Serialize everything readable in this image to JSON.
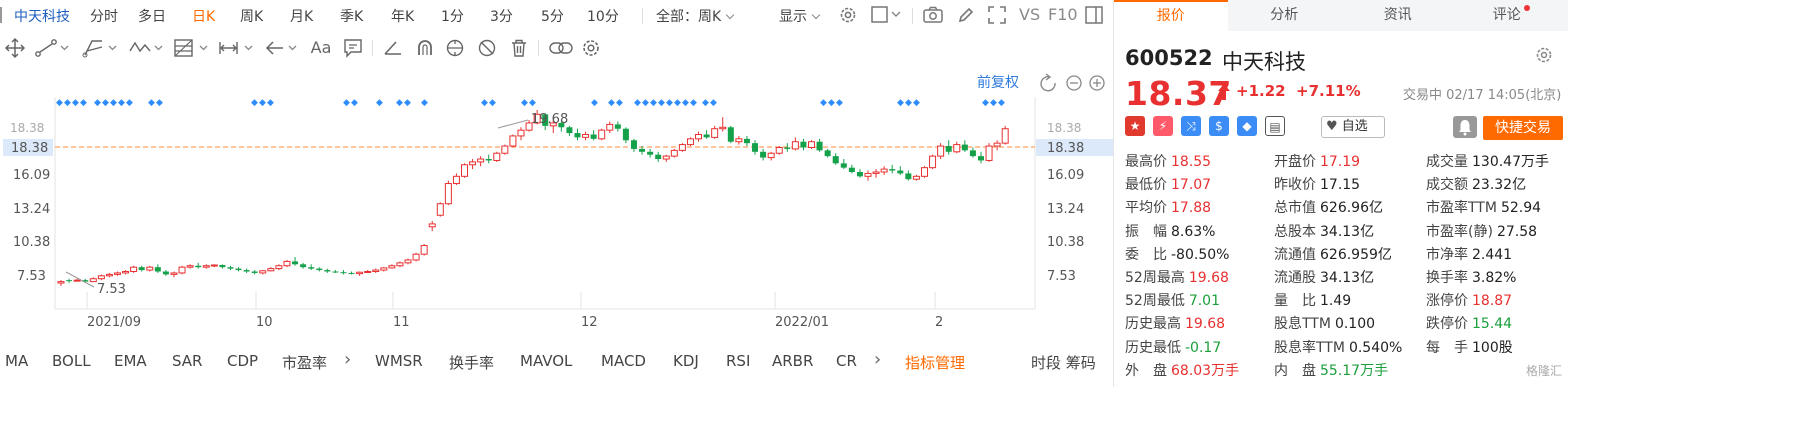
{
  "tabs": {
    "name": "中天科技",
    "items": [
      "分时",
      "多日",
      "日K",
      "周K",
      "月K",
      "季K",
      "年K",
      "1分",
      "3分",
      "5分",
      "10分"
    ],
    "active": "日K",
    "adjust_select": "全部：周K",
    "display": "显示",
    "vs_label": "VS",
    "f10_label": "F10"
  },
  "chart": {
    "adjust_label": "前复权",
    "price_levels": [
      "18.38",
      "16.09",
      "13.24",
      "10.38",
      "7.53"
    ],
    "current_price_tag": "18.38",
    "annotation_high": "19.68",
    "annotation_low": "7.53",
    "x_labels": [
      "2021/09",
      "10",
      "11",
      "12",
      "2022/01",
      "2"
    ],
    "colors": {
      "up": "#e93030",
      "down": "#14a14a",
      "ref_line": "#ff8a3d",
      "marker": "#2f8cff"
    }
  },
  "chart_data": {
    "type": "candlestick",
    "ylim": [
      5.9,
      20.6
    ],
    "y_ticks": [
      7.53,
      10.38,
      13.24,
      16.09,
      18.38
    ],
    "x_labels": [
      "2021/09",
      "10",
      "11",
      "12",
      "2022/01",
      "2"
    ],
    "high_marker": 19.68,
    "low_marker": 7.53,
    "reference_price": 18.38,
    "ohlc": [
      [
        7.7,
        7.9,
        7.5,
        7.8
      ],
      [
        7.9,
        8.0,
        7.7,
        7.85
      ],
      [
        7.85,
        8.0,
        7.8,
        7.9
      ],
      [
        7.9,
        8.0,
        7.7,
        7.8
      ],
      [
        7.8,
        8.1,
        7.8,
        8.0
      ],
      [
        8.0,
        8.3,
        7.9,
        8.2
      ],
      [
        8.2,
        8.4,
        8.1,
        8.3
      ],
      [
        8.3,
        8.5,
        8.2,
        8.4
      ],
      [
        8.4,
        8.6,
        8.3,
        8.5
      ],
      [
        8.5,
        8.9,
        8.4,
        8.8
      ],
      [
        8.8,
        8.9,
        8.5,
        8.6
      ],
      [
        8.6,
        8.9,
        8.5,
        8.8
      ],
      [
        8.8,
        9.0,
        8.4,
        8.5
      ],
      [
        8.5,
        8.6,
        8.2,
        8.3
      ],
      [
        8.3,
        8.5,
        8.1,
        8.4
      ],
      [
        8.4,
        8.9,
        8.3,
        8.8
      ],
      [
        8.8,
        9.0,
        8.7,
        8.9
      ],
      [
        8.9,
        9.1,
        8.7,
        8.8
      ],
      [
        8.8,
        9.0,
        8.7,
        8.9
      ],
      [
        8.9,
        9.0,
        8.8,
        8.95
      ],
      [
        8.95,
        9.0,
        8.7,
        8.8
      ],
      [
        8.8,
        8.9,
        8.6,
        8.7
      ],
      [
        8.7,
        8.8,
        8.5,
        8.6
      ],
      [
        8.6,
        8.7,
        8.4,
        8.5
      ],
      [
        8.5,
        8.6,
        8.3,
        8.4
      ],
      [
        8.4,
        8.6,
        8.3,
        8.55
      ],
      [
        8.55,
        8.8,
        8.5,
        8.7
      ],
      [
        8.7,
        9.0,
        8.6,
        8.9
      ],
      [
        8.9,
        9.3,
        8.8,
        9.2
      ],
      [
        9.2,
        9.5,
        8.9,
        9.0
      ],
      [
        9.0,
        9.1,
        8.7,
        8.8
      ],
      [
        8.8,
        9.0,
        8.6,
        8.7
      ],
      [
        8.7,
        8.8,
        8.5,
        8.6
      ],
      [
        8.6,
        8.7,
        8.4,
        8.5
      ],
      [
        8.5,
        8.6,
        8.4,
        8.45
      ],
      [
        8.45,
        8.6,
        8.3,
        8.4
      ],
      [
        8.4,
        8.5,
        8.3,
        8.35
      ],
      [
        8.35,
        8.5,
        8.2,
        8.45
      ],
      [
        8.45,
        8.6,
        8.4,
        8.5
      ],
      [
        8.5,
        8.7,
        8.4,
        8.6
      ],
      [
        8.6,
        8.8,
        8.5,
        8.75
      ],
      [
        8.75,
        9.0,
        8.7,
        8.9
      ],
      [
        8.9,
        9.2,
        8.8,
        9.1
      ],
      [
        9.1,
        9.4,
        9.0,
        9.3
      ],
      [
        9.3,
        9.8,
        9.2,
        9.7
      ],
      [
        9.7,
        10.4,
        9.6,
        10.3
      ],
      [
        11.6,
        12.0,
        11.3,
        11.8
      ],
      [
        12.4,
        13.3,
        12.3,
        13.2
      ],
      [
        13.2,
        14.8,
        13.1,
        14.6
      ],
      [
        14.6,
        15.3,
        14.5,
        15.1
      ],
      [
        15.1,
        16.0,
        15.0,
        15.9
      ],
      [
        15.9,
        16.3,
        15.6,
        16.1
      ],
      [
        16.1,
        16.5,
        15.8,
        16.3
      ],
      [
        16.3,
        16.6,
        16.0,
        16.2
      ],
      [
        16.2,
        16.8,
        16.1,
        16.7
      ],
      [
        16.7,
        17.3,
        16.6,
        17.2
      ],
      [
        17.2,
        18.0,
        17.1,
        17.9
      ],
      [
        17.9,
        18.5,
        17.6,
        18.3
      ],
      [
        18.3,
        19.0,
        18.2,
        18.8
      ],
      [
        18.8,
        19.7,
        18.7,
        19.4
      ],
      [
        19.4,
        19.5,
        18.3,
        18.6
      ],
      [
        18.6,
        19.0,
        18.1,
        18.8
      ],
      [
        18.8,
        18.9,
        18.2,
        18.5
      ],
      [
        18.5,
        18.6,
        17.9,
        18.1
      ],
      [
        18.1,
        18.4,
        17.6,
        17.8
      ],
      [
        17.8,
        18.2,
        17.6,
        18.0
      ],
      [
        18.0,
        18.3,
        17.6,
        17.7
      ],
      [
        17.7,
        18.4,
        17.6,
        18.3
      ],
      [
        18.3,
        18.9,
        18.1,
        18.7
      ],
      [
        18.7,
        18.9,
        18.2,
        18.4
      ],
      [
        18.4,
        18.5,
        17.4,
        17.6
      ],
      [
        17.6,
        17.7,
        16.8,
        17.0
      ],
      [
        17.0,
        17.2,
        16.6,
        16.8
      ],
      [
        16.8,
        17.0,
        16.4,
        16.6
      ],
      [
        16.6,
        16.8,
        16.1,
        16.3
      ],
      [
        16.3,
        16.6,
        16.1,
        16.5
      ],
      [
        16.5,
        17.0,
        16.4,
        16.9
      ],
      [
        16.9,
        17.4,
        16.8,
        17.3
      ],
      [
        17.3,
        17.8,
        17.2,
        17.7
      ],
      [
        17.7,
        18.2,
        17.5,
        18.0
      ],
      [
        18.0,
        18.3,
        17.7,
        17.8
      ],
      [
        17.8,
        18.6,
        17.7,
        18.4
      ],
      [
        18.4,
        19.2,
        18.2,
        18.5
      ],
      [
        18.5,
        18.6,
        17.4,
        17.5
      ],
      [
        17.5,
        17.9,
        17.3,
        17.7
      ],
      [
        17.7,
        17.9,
        17.2,
        17.4
      ],
      [
        17.4,
        17.6,
        16.6,
        16.8
      ],
      [
        16.8,
        17.0,
        16.2,
        16.4
      ],
      [
        16.4,
        16.8,
        16.2,
        16.7
      ],
      [
        16.7,
        17.2,
        16.6,
        17.1
      ],
      [
        17.1,
        17.4,
        16.8,
        17.0
      ],
      [
        17.0,
        17.8,
        16.9,
        17.5
      ],
      [
        17.5,
        17.7,
        16.9,
        17.1
      ],
      [
        17.1,
        17.6,
        17.0,
        17.5
      ],
      [
        17.5,
        17.7,
        16.8,
        16.9
      ],
      [
        16.9,
        17.0,
        16.4,
        16.5
      ],
      [
        16.5,
        16.7,
        15.9,
        16.0
      ],
      [
        16.0,
        16.3,
        15.6,
        15.7
      ],
      [
        15.7,
        15.9,
        15.3,
        15.4
      ],
      [
        15.4,
        15.6,
        15.0,
        15.1
      ],
      [
        15.1,
        15.5,
        14.8,
        15.3
      ],
      [
        15.3,
        15.6,
        15.0,
        15.4
      ],
      [
        15.4,
        15.8,
        15.2,
        15.6
      ],
      [
        15.6,
        15.9,
        15.3,
        15.5
      ],
      [
        15.5,
        15.8,
        15.2,
        15.3
      ],
      [
        15.3,
        15.5,
        14.8,
        14.9
      ],
      [
        14.9,
        15.2,
        14.8,
        15.1
      ],
      [
        15.1,
        15.8,
        15.0,
        15.7
      ],
      [
        15.7,
        16.6,
        15.6,
        16.5
      ],
      [
        16.5,
        17.4,
        16.3,
        17.2
      ],
      [
        17.2,
        17.6,
        16.6,
        16.8
      ],
      [
        16.8,
        17.5,
        16.7,
        17.3
      ],
      [
        17.3,
        17.6,
        16.8,
        16.9
      ],
      [
        16.9,
        17.1,
        16.4,
        16.5
      ],
      [
        16.5,
        16.8,
        16.0,
        16.2
      ],
      [
        16.2,
        17.4,
        16.1,
        17.2
      ],
      [
        17.2,
        17.6,
        16.9,
        17.4
      ],
      [
        17.4,
        18.6,
        17.3,
        18.4
      ]
    ]
  },
  "marker_glyph": "◆",
  "marker_groups": [
    [
      60,
      68,
      76,
      84
    ],
    [
      98,
      106,
      114,
      122,
      130
    ],
    [
      152,
      160
    ],
    [
      255,
      263,
      271
    ],
    [
      347,
      355
    ],
    [
      380
    ],
    [
      400,
      408
    ],
    [
      425
    ],
    [
      485,
      493
    ],
    [
      525,
      533
    ],
    [
      595
    ],
    [
      612,
      620
    ],
    [
      638,
      646,
      654,
      662,
      670,
      678,
      686,
      694
    ],
    [
      706,
      714
    ],
    [
      824,
      832,
      840
    ],
    [
      901,
      909,
      917
    ],
    [
      986,
      994,
      1002
    ]
  ],
  "toolbar": {
    "icons": [
      "crosshair-icon",
      "line-icon",
      "channel-icon",
      "wave-icon",
      "fib-icon",
      "range-icon",
      "arrow-icon",
      "text-icon",
      "comment-icon",
      "draw-icon",
      "magnet-icon",
      "eye-icon",
      "hide-icon",
      "trash-icon",
      "link-icon",
      "settings-icon"
    ]
  },
  "indicators": {
    "items": [
      "MA",
      "BOLL",
      "EMA",
      "SAR",
      "CDP",
      "市盈率",
      "WMSR",
      "换手率",
      "MAVOL",
      "MACD",
      "KDJ",
      "RSI",
      "ARBR",
      "CR"
    ],
    "manage": "指标管理",
    "tail": "时段 筹码"
  },
  "quote": {
    "tabs": [
      "报价",
      "分析",
      "资讯",
      "评论"
    ],
    "active_tab": "报价",
    "code": "600522",
    "name": "中天科技",
    "price": "18.37",
    "change": "+1.22",
    "change_pct": "+7.11%",
    "status": "交易中 02/17 14:05(北京)",
    "watch": "自选",
    "fast_trade": "快捷交易",
    "fields": [
      {
        "label": "最高价",
        "value": "18.55",
        "tone": "red"
      },
      {
        "label": "开盘价",
        "value": "17.19",
        "tone": "red"
      },
      {
        "label": "成交量",
        "value": "130.47万手",
        "tone": "dark"
      },
      {
        "label": "最低价",
        "value": "17.07",
        "tone": "red"
      },
      {
        "label": "昨收价",
        "value": "17.15",
        "tone": "dark"
      },
      {
        "label": "成交额",
        "value": "23.32亿",
        "tone": "dark"
      },
      {
        "label": "平均价",
        "value": "17.88",
        "tone": "red"
      },
      {
        "label": "总市值",
        "value": "626.96亿",
        "tone": "dark"
      },
      {
        "label": "市盈率TTM",
        "value": "52.94",
        "tone": "dark"
      },
      {
        "label": "振　幅",
        "value": "8.63%",
        "tone": "dark"
      },
      {
        "label": "总股本",
        "value": "34.13亿",
        "tone": "dark"
      },
      {
        "label": "市盈率(静)",
        "value": "27.58",
        "tone": "dark"
      },
      {
        "label": "委　比",
        "value": "-80.50%",
        "tone": "dark"
      },
      {
        "label": "流通值",
        "value": "626.959亿",
        "tone": "dark"
      },
      {
        "label": "市净率",
        "value": "2.441",
        "tone": "dark"
      },
      {
        "label": "52周最高",
        "value": "19.68",
        "tone": "red"
      },
      {
        "label": "流通股",
        "value": "34.13亿",
        "tone": "dark"
      },
      {
        "label": "换手率",
        "value": "3.82%",
        "tone": "dark"
      },
      {
        "label": "52周最低",
        "value": "7.01",
        "tone": "green"
      },
      {
        "label": "量　比",
        "value": "1.49",
        "tone": "dark"
      },
      {
        "label": "涨停价",
        "value": "18.87",
        "tone": "red"
      },
      {
        "label": "历史最高",
        "value": "19.68",
        "tone": "red"
      },
      {
        "label": "股息TTM",
        "value": "0.100",
        "tone": "dark"
      },
      {
        "label": "跌停价",
        "value": "15.44",
        "tone": "green"
      },
      {
        "label": "历史最低",
        "value": "-0.17",
        "tone": "green"
      },
      {
        "label": "股息率TTM",
        "value": "0.540%",
        "tone": "dark"
      },
      {
        "label": "每　手",
        "value": "100股",
        "tone": "dark"
      },
      {
        "label": "外　盘",
        "value": "68.03万手",
        "tone": "red"
      },
      {
        "label": "内　盘",
        "value": "55.17万手",
        "tone": "green"
      }
    ]
  },
  "watermark": "格隆汇"
}
